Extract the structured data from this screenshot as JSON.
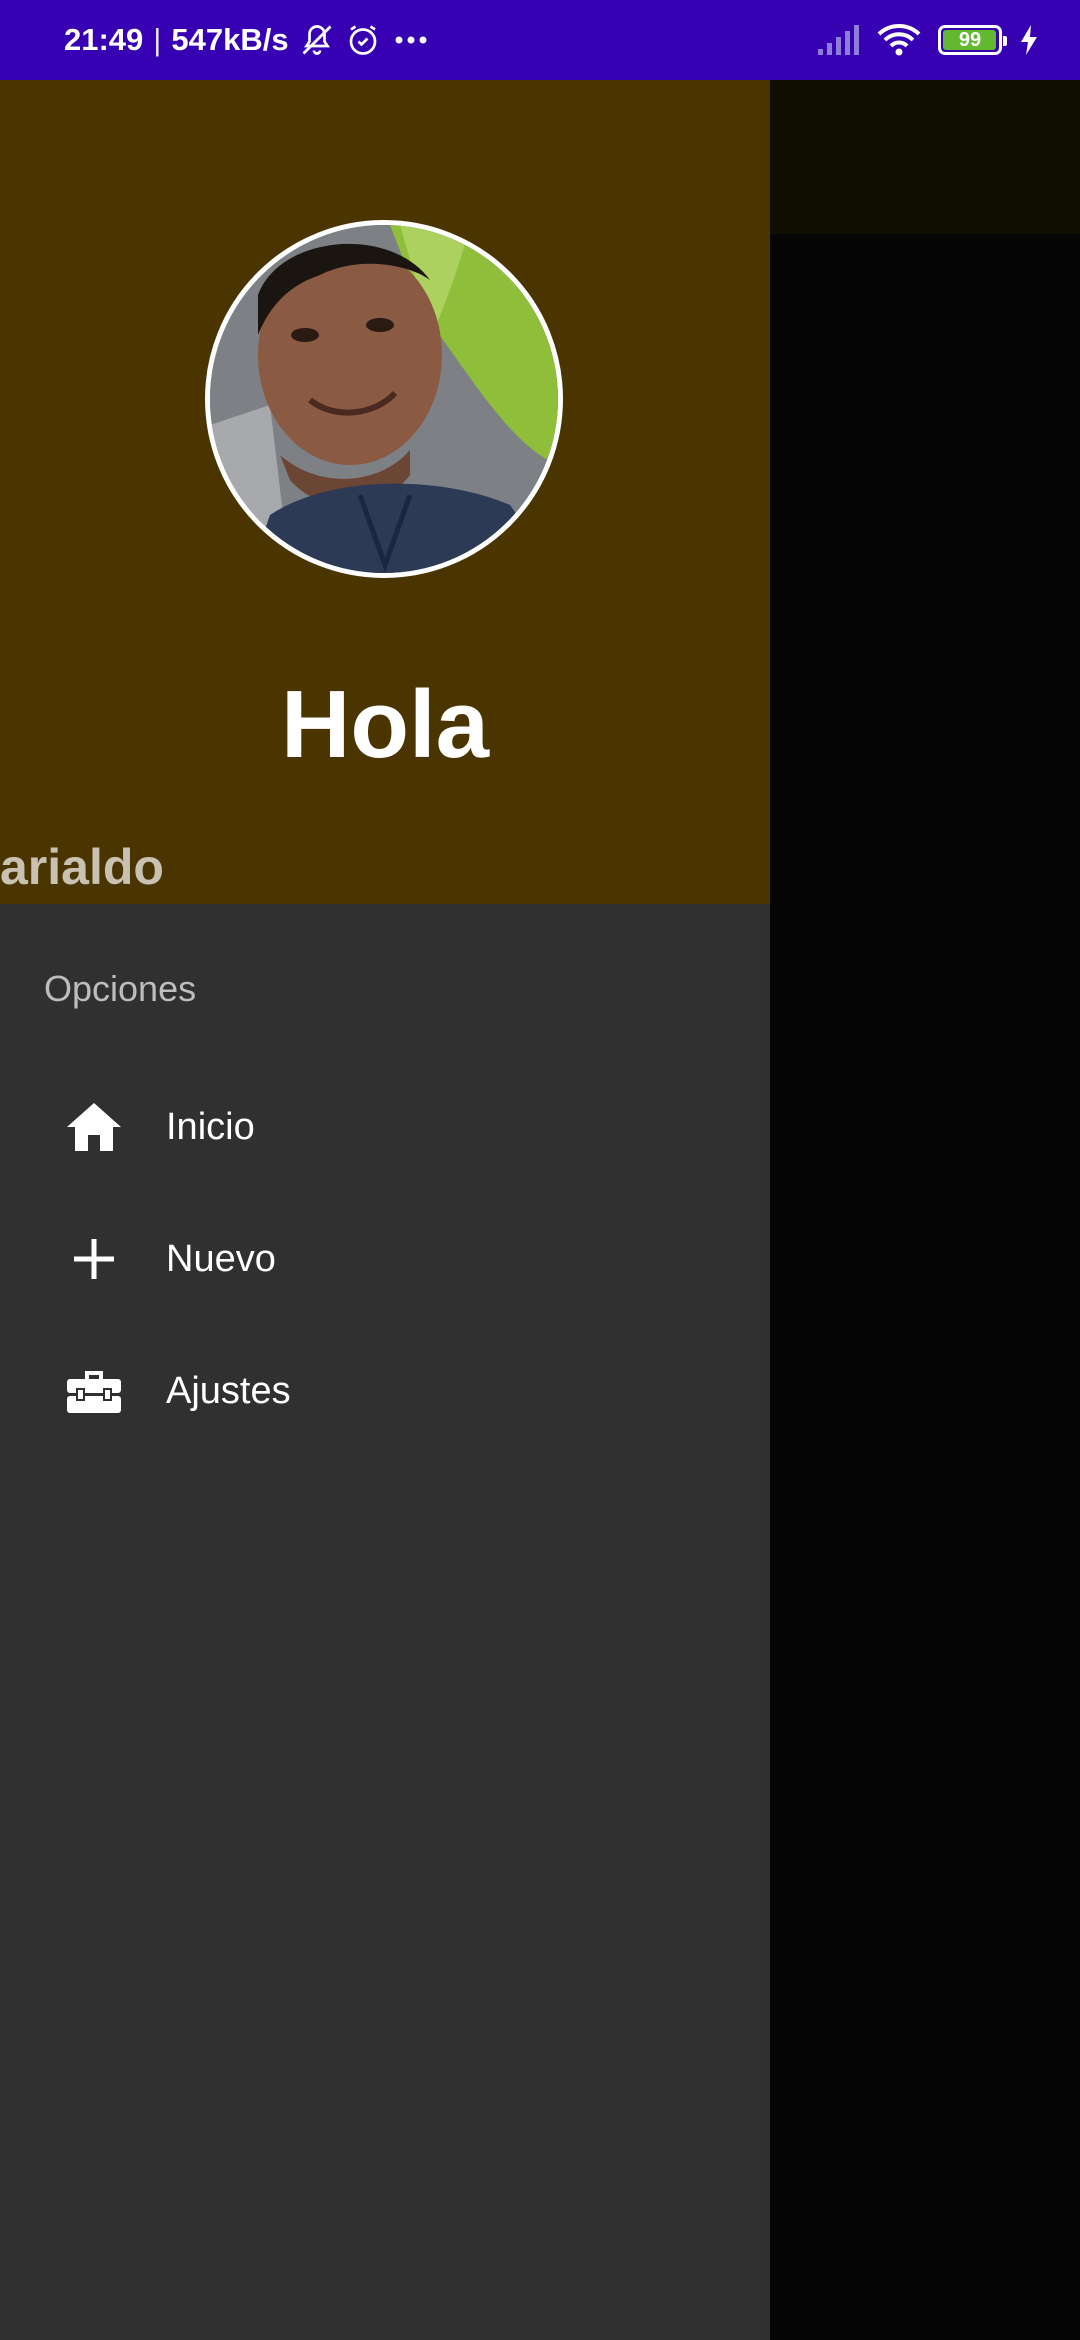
{
  "status_bar": {
    "time": "21:49",
    "separator": "|",
    "network_speed": "547kB/s",
    "battery_level": "99",
    "battery_fraction": 0.99,
    "icons": [
      "notifications-off-icon",
      "alarm-icon",
      "more-dots-icon",
      "signal-icon",
      "wifi-icon",
      "battery-icon",
      "charging-icon"
    ]
  },
  "drawer": {
    "header": {
      "greeting": "Hola",
      "user_name": "arialdo"
    },
    "section_title": "Opciones",
    "items": [
      {
        "label": "Inicio",
        "icon": "home-icon"
      },
      {
        "label": "Nuevo",
        "icon": "plus-icon"
      },
      {
        "label": "Ajustes",
        "icon": "toolbox-icon"
      }
    ]
  },
  "colors": {
    "status_bar": "#3700b3",
    "drawer_header": "#4a3500",
    "drawer_body": "#303030",
    "scrim": "#050505"
  }
}
